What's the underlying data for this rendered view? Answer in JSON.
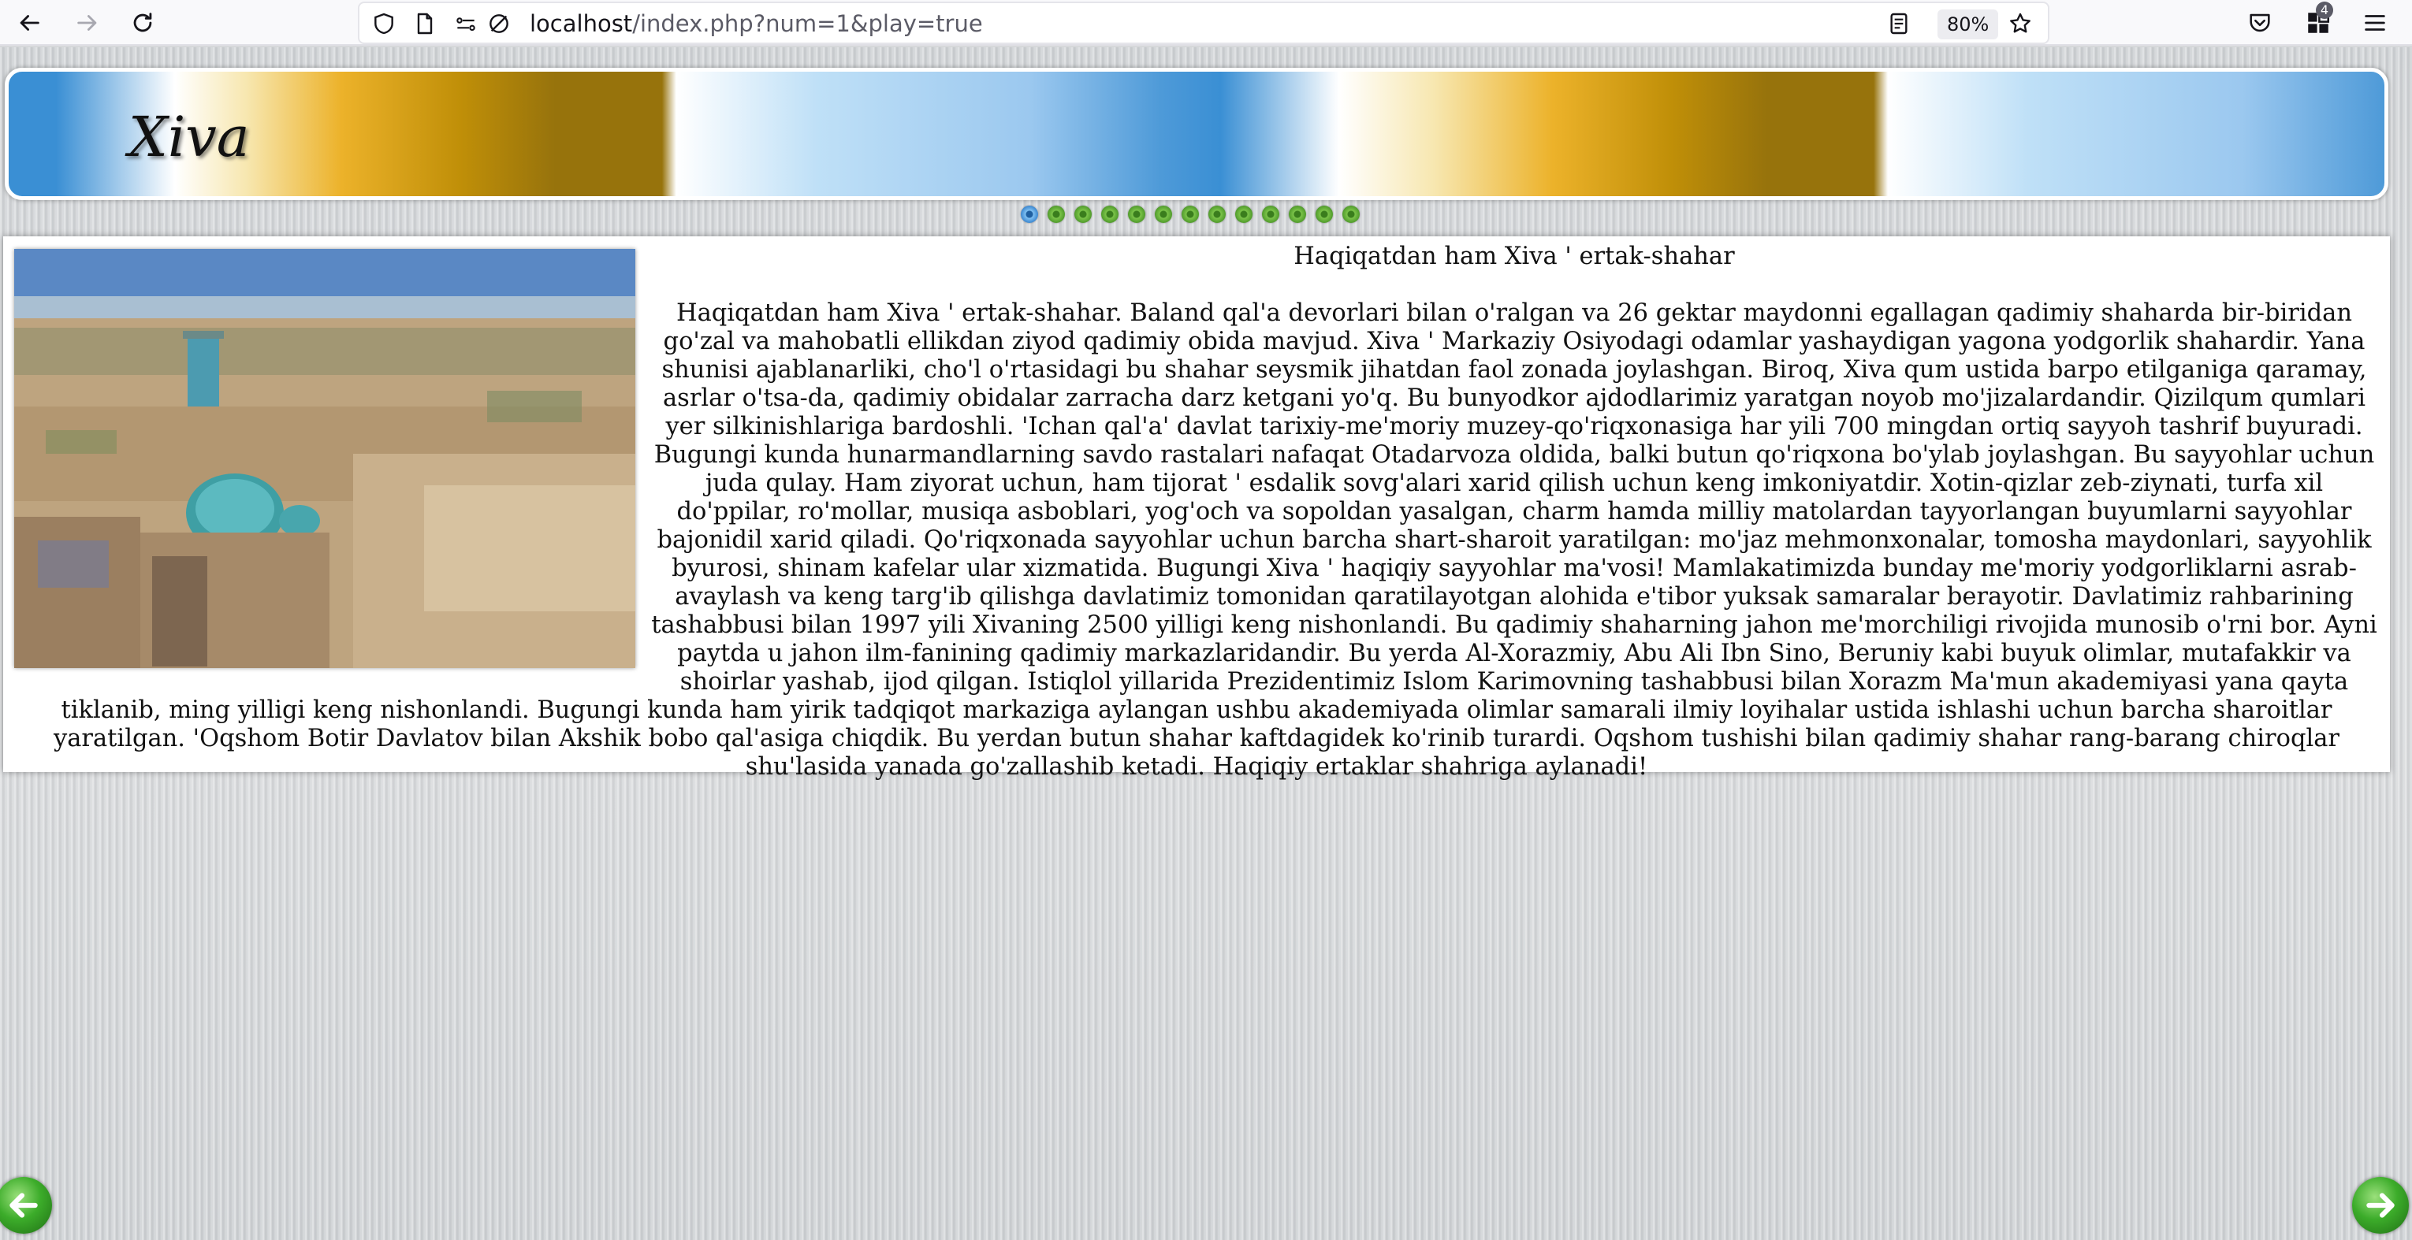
{
  "browser": {
    "url_host": "localhost",
    "url_path": "/index.php?num=1&play=true",
    "zoom": "80%",
    "extensions_count": "4"
  },
  "banner": {
    "title": "Xiva"
  },
  "slides": {
    "count": 13,
    "active_index": 0
  },
  "article": {
    "title": "Haqiqatdan ham Xiva ' ertak-shahar",
    "body": "Haqiqatdan ham Xiva ' ertak-shahar. Baland qal'a devorlari bilan o'ralgan va 26 gektar maydonni egallagan qadimiy shaharda bir-biridan go'zal va mahobatli ellikdan ziyod qadimiy obida mavjud. Xiva ' Markaziy Osiyodagi odamlar yashaydigan yagona yodgorlik shahardir. Yana shunisi ajablanarliki, cho'l o'rtasidagi bu shahar seysmik jihatdan faol zonada joylashgan. Biroq, Xiva qum ustida barpo etilganiga qaramay, asrlar o'tsa-da, qadimiy obidalar zarracha darz ketgani yo'q. Bu bunyodkor ajdodlarimiz yaratgan noyob mo'jizalardandir. Qizilqum qumlari yer silkinishlariga bardoshli. 'Ichan qal'a' davlat tarixiy-me'moriy muzey-qo'riqxonasiga har yili 700 mingdan ortiq sayyoh tashrif buyuradi. Bugungi kunda hunarmandlarning savdo rastalari nafaqat Otadarvoza oldida, balki butun qo'riqxona bo'ylab joylashgan. Bu sayyohlar uchun juda qulay. Ham ziyorat uchun, ham tijorat ' esdalik sovg'alari xarid qilish uchun keng imkoniyatdir. Xotin-qizlar zeb-ziynati, turfa xil do'ppilar, ro'mollar, musiqa asboblari, yog'och va sopoldan yasalgan, charm hamda milliy matolardan tayyorlangan buyumlarni sayyohlar bajonidil xarid qiladi. Qo'riqxonada sayyohlar uchun barcha shart-sharoit yaratilgan: mo'jaz mehmonxonalar, tomosha maydonlari, sayyohlik byurosi, shinam kafelar ular xizmatida. Bugungi Xiva ' haqiqiy sayyohlar ma'vosi! Mamlakatimizda bunday me'moriy yodgorliklarni asrab-avaylash va keng targ'ib qilishga davlatimiz tomonidan qaratilayotgan alohida e'tibor yuksak samaralar berayotir. Davlatimiz rahbarining tashabbusi bilan 1997 yili Xivaning 2500 yilligi keng nishonlandi. Bu qadimiy shaharning jahon me'morchiligi rivojida munosib o'rni bor. Ayni paytda u jahon ilm-fanining qadimiy markazlaridandir. Bu yerda Al-Xorazmiy, Abu Ali Ibn Sino, Beruniy kabi buyuk olimlar, mutafakkir va shoirlar yashab, ijod qilgan. Istiqlol yillarida Prezidentimiz Islom Karimovning tashabbusi bilan Xorazm Ma'mun akademiyasi yana qayta tiklanib, ming yilligi keng nishonlandi. Bugungi kunda ham yirik tadqiqot markaziga aylangan ushbu akademiyada olimlar samarali ilmiy loyihalar ustida ishlashi uchun barcha sharoitlar yaratilgan. 'Oqshom Botir Davlatov bilan Akshik bobo qal'asiga chiqdik. Bu yerdan butun shahar kaftdagidek ko'rinib turardi. Oqshom tushishi bilan qadimiy shahar rang-barang chiroqlar shu'lasida yanada go'zallashib ketadi. Haqiqiy ertaklar shahriga aylanadi!"
  },
  "colors": {
    "banner_blue": "#3a8fd4",
    "banner_gold": "#c08f08",
    "dot_green": "#4f9a2b",
    "dot_active_blue": "#3b86cf"
  },
  "icons": {
    "back": "arrow-left-icon",
    "forward": "arrow-right-icon",
    "reload": "reload-icon",
    "prev_slide": "green-arrow-left-icon",
    "next_slide": "green-arrow-right-icon"
  }
}
